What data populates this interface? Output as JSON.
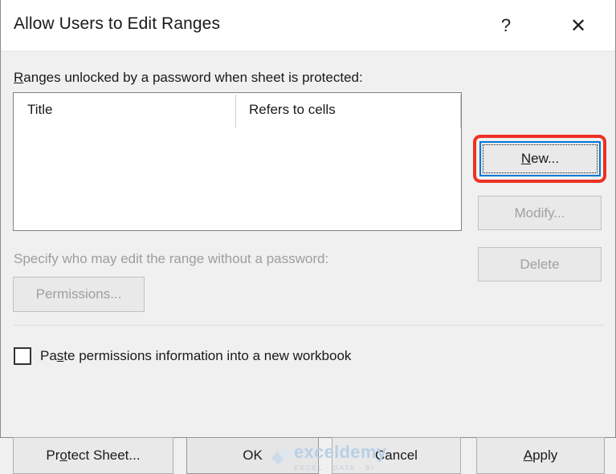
{
  "window": {
    "title": "Allow Users to Edit Ranges",
    "help_icon": "question-mark-icon",
    "close_icon": "close-x-icon"
  },
  "main": {
    "ranges_label_prefix": "",
    "ranges_label_accel": "R",
    "ranges_label_rest": "anges unlocked by a password when sheet is protected:",
    "ranges_label_full": "Ranges unlocked by a password when sheet is protected:",
    "list": {
      "columns": [
        "Title",
        "Refers to cells"
      ],
      "rows": []
    },
    "side_buttons": [
      {
        "label_accel": "N",
        "label_rest": "ew...",
        "label_full": "New...",
        "state": "focused"
      },
      {
        "label_accel": "",
        "label_rest": "Modify...",
        "label_full": "Modify...",
        "state": "disabled"
      },
      {
        "label_accel": "",
        "label_rest": "Delete",
        "label_full": "Delete",
        "state": "disabled"
      }
    ],
    "specify_label": "Specify who may edit the range without a password:",
    "permissions_button": "Permissions...",
    "checkbox": {
      "checked": false,
      "label_pre": "Pa",
      "label_accel": "s",
      "label_post": "te permissions information into a new workbook",
      "label_full": "Paste permissions information into a new workbook"
    }
  },
  "footer": {
    "protect": {
      "pre": "Pr",
      "accel": "o",
      "post": "tect Sheet...",
      "full": "Protect Sheet..."
    },
    "ok": {
      "pre": "",
      "accel": "",
      "post": "OK",
      "full": "OK"
    },
    "cancel": {
      "pre": "",
      "accel": "",
      "post": "Cancel",
      "full": "Cancel"
    },
    "apply": {
      "pre": "",
      "accel": "A",
      "post": "pply",
      "full": "Apply"
    }
  },
  "watermark": {
    "main": "exceldemy",
    "sub": "EXCEL · DATA · BI"
  },
  "colors": {
    "accent_focus": "#0078d7",
    "annotation_red": "#ee3124",
    "dialog_bg": "#f0f0f0",
    "titlebar_bg": "#ffffff",
    "disabled_text": "#a0a0a0"
  }
}
